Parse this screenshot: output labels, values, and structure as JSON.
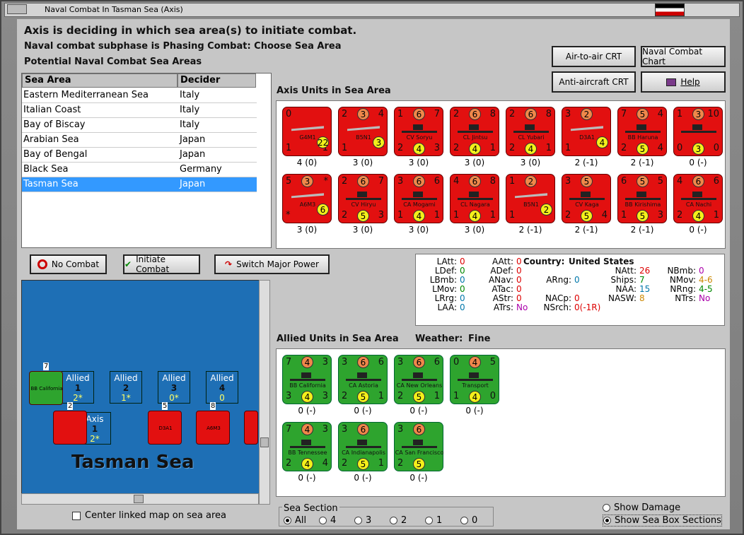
{
  "window": {
    "title": "Naval Combat In Tasman Sea (Axis)"
  },
  "header": {
    "line1": "Axis is deciding in which sea area(s) to initiate combat.",
    "line2": "Naval combat subphase is Phasing Combat: Choose Sea Area",
    "line3": "Potential Naval Combat Sea Areas"
  },
  "buttons": {
    "air_crt": "Air-to-air CRT",
    "naval_chart": "Naval Combat Chart",
    "aa_crt": "Anti-aircraft CRT",
    "help": "Help",
    "no_combat": "No Combat",
    "initiate": "Initiate Combat",
    "switch": "Switch Major Power"
  },
  "table": {
    "col_area": "Sea Area",
    "col_decider": "Decider",
    "rows": [
      {
        "area": "Eastern Mediterranean Sea",
        "decider": "Italy"
      },
      {
        "area": "Italian Coast",
        "decider": "Italy"
      },
      {
        "area": "Bay of Biscay",
        "decider": "Italy"
      },
      {
        "area": "Arabian Sea",
        "decider": "Japan"
      },
      {
        "area": "Bay of Bengal",
        "decider": "Japan"
      },
      {
        "area": "Black Sea",
        "decider": "Germany"
      },
      {
        "area": "Tasman Sea",
        "decider": "Japan"
      }
    ]
  },
  "axis_units": {
    "title": "Axis Units in Sea Area",
    "units": [
      {
        "tl": "0",
        "top": "",
        "tr": "",
        "bl": "1",
        "name": "G4M1",
        "br": "1",
        "circ": "22",
        "sub": "4 (0)",
        "kind": "plane"
      },
      {
        "tl": "2",
        "top": "3",
        "tr": "4",
        "bl": "1",
        "name": "B5N1",
        "br": "*",
        "circ": "3",
        "sub": "3 (0)",
        "kind": "plane"
      },
      {
        "tl": "1",
        "top": "6",
        "tr": "7",
        "bl": "2",
        "name": "CV Soryu",
        "br": "3",
        "circ": "4",
        "sub": "3 (0)",
        "kind": "ship"
      },
      {
        "tl": "2",
        "top": "6",
        "tr": "8",
        "bl": "2",
        "name": "CL Jintsu",
        "br": "1",
        "circ": "4",
        "sub": "3 (0)",
        "kind": "ship"
      },
      {
        "tl": "2",
        "top": "6",
        "tr": "8",
        "bl": "2",
        "name": "CL Yubari",
        "br": "1",
        "circ": "4",
        "sub": "3 (0)",
        "kind": "ship"
      },
      {
        "tl": "3",
        "top": "2",
        "tr": "",
        "bl": "1",
        "name": "D3A1",
        "br": "*",
        "circ": "4",
        "sub": "2 (-1)",
        "kind": "plane"
      },
      {
        "tl": "7",
        "top": "5",
        "tr": "4",
        "bl": "2",
        "name": "BB Haruna",
        "br": "4",
        "circ": "5",
        "sub": "2 (-1)",
        "kind": "ship"
      },
      {
        "tl": "1",
        "top": "3",
        "tr": "10",
        "bl": "0",
        "name": "",
        "br": "0",
        "circ": "3",
        "sub": "0 (-)",
        "kind": "ship"
      },
      {
        "tl": "5",
        "top": "3",
        "tr": "*",
        "bl": "*",
        "name": "A6M3",
        "br": "*",
        "circ": "6",
        "sub": "3 (0)",
        "kind": "plane"
      },
      {
        "tl": "2",
        "top": "6",
        "tr": "7",
        "bl": "2",
        "name": "CV Hiryu",
        "br": "3",
        "circ": "5",
        "sub": "3 (0)",
        "kind": "ship"
      },
      {
        "tl": "3",
        "top": "6",
        "tr": "6",
        "bl": "1",
        "name": "CA Mogami",
        "br": "1",
        "circ": "4",
        "sub": "3 (0)",
        "kind": "ship"
      },
      {
        "tl": "4",
        "top": "6",
        "tr": "8",
        "bl": "1",
        "name": "CL Nagara",
        "br": "1",
        "circ": "4",
        "sub": "3 (0)",
        "kind": "ship"
      },
      {
        "tl": "1",
        "top": "2",
        "tr": "",
        "bl": "1",
        "name": "B5N1",
        "br": "*",
        "circ": "2",
        "sub": "2 (-1)",
        "kind": "plane"
      },
      {
        "tl": "3",
        "top": "5",
        "tr": "",
        "bl": "2",
        "name": "CV Kaga",
        "br": "4",
        "circ": "5",
        "sub": "2 (-1)",
        "kind": "ship"
      },
      {
        "tl": "6",
        "top": "5",
        "tr": "5",
        "bl": "1",
        "name": "BB Kirishima",
        "br": "3",
        "circ": "5",
        "sub": "2 (-1)",
        "kind": "ship"
      },
      {
        "tl": "4",
        "top": "6",
        "tr": "6",
        "bl": "2",
        "name": "CA Nachi",
        "br": "1",
        "circ": "4",
        "sub": "0 (-)",
        "kind": "ship"
      }
    ]
  },
  "stats": {
    "country_label": "Country:",
    "country": "United States",
    "col1": [
      [
        "LAtt:",
        "0"
      ],
      [
        "LDef:",
        "0"
      ],
      [
        "LBmb:",
        "0"
      ],
      [
        "LMov:",
        "0"
      ],
      [
        "LRrg:",
        "0"
      ],
      [
        "LAA:",
        "0"
      ]
    ],
    "col2": [
      [
        "AAtt:",
        "0"
      ],
      [
        "ADef:",
        "0"
      ],
      [
        "ANav:",
        "0"
      ],
      [
        "ATac:",
        "0"
      ],
      [
        "AStr:",
        "0"
      ],
      [
        "ATrs:",
        "No"
      ]
    ],
    "col3": [
      [
        "ARng:",
        "0"
      ],
      [
        "NACp:",
        "0"
      ],
      [
        "NSrch:",
        "0(-1R)"
      ]
    ],
    "col4": [
      [
        "NAtt:",
        "26"
      ],
      [
        "Ships:",
        "7"
      ],
      [
        "NAA:",
        "15"
      ],
      [
        "NASW:",
        "8"
      ]
    ],
    "col5": [
      [
        "NBmb:",
        "0"
      ],
      [
        "NMov:",
        "4-6"
      ],
      [
        "NRng:",
        "4-5"
      ],
      [
        "NTrs:",
        "No"
      ]
    ]
  },
  "allied_units": {
    "title": "Allied Units in Sea Area",
    "weather_label": "Weather:",
    "weather": "Fine",
    "units": [
      {
        "tl": "7",
        "top": "4",
        "tr": "3",
        "bl": "3",
        "name": "BB California",
        "br": "3",
        "circ": "4",
        "sub": "0 (-)"
      },
      {
        "tl": "3",
        "top": "6",
        "tr": "6",
        "bl": "2",
        "name": "CA Astoria",
        "br": "1",
        "circ": "5",
        "sub": "0 (-)"
      },
      {
        "tl": "3",
        "top": "6",
        "tr": "6",
        "bl": "2",
        "name": "CA New Orleans",
        "br": "1",
        "circ": "5",
        "sub": "0 (-)"
      },
      {
        "tl": "0",
        "top": "4",
        "tr": "5",
        "bl": "1",
        "name": "Transport",
        "br": "0",
        "circ": "4",
        "sub": "0 (-)"
      },
      {
        "tl": "7",
        "top": "4",
        "tr": "3",
        "bl": "2",
        "name": "BB Tennessee",
        "br": "4",
        "circ": "4",
        "sub": "0 (-)"
      },
      {
        "tl": "3",
        "top": "6",
        "tr": "",
        "bl": "2",
        "name": "CA Indianapolis",
        "br": "1",
        "circ": "5",
        "sub": "0 (-)"
      },
      {
        "tl": "3",
        "top": "6",
        "tr": "",
        "bl": "2",
        "name": "CA San Francisco",
        "br": "",
        "circ": "5",
        "sub": "0 (-)"
      }
    ]
  },
  "map": {
    "sea_name": "Tasman Sea",
    "boxes": [
      {
        "label": "Allied",
        "num": "1",
        "val": "2*"
      },
      {
        "label": "Allied",
        "num": "2",
        "val": "1*"
      },
      {
        "label": "Allied",
        "num": "3",
        "val": "0*"
      },
      {
        "label": "Allied",
        "num": "4",
        "val": "0"
      },
      {
        "label": "Axis",
        "num": "1",
        "val": "2*"
      }
    ],
    "stack_counts": [
      "7",
      "2",
      "5",
      "8"
    ],
    "mini_labels": [
      "BB California",
      "D3A1",
      "A6M3"
    ]
  },
  "footer": {
    "center_map": "Center linked map on sea area",
    "sea_section": "Sea Section",
    "sections": [
      "All",
      "4",
      "3",
      "2",
      "1",
      "0"
    ],
    "show_damage": "Show Damage",
    "show_boxes": "Show Sea Box Sections"
  },
  "colors": {
    "axis": "#e21010",
    "allied": "#2ea42e",
    "selected": "#3399ff",
    "sea": "#1e6fb5"
  }
}
